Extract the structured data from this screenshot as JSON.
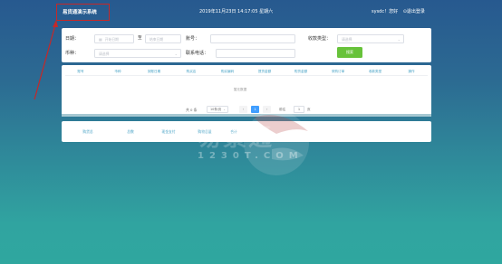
{
  "header": {
    "app_title": "易货通演示系统",
    "datetime": "2019年11月23日 14:17:05 星期六",
    "greeting": "sysdc！您好",
    "logout": "⊙退出登录"
  },
  "filters": {
    "date_label": "日期：",
    "date_start_placeholder": "开始日期",
    "date_separator": "至",
    "date_end_placeholder": "结束日期",
    "account_label": "账号：",
    "account_value": "",
    "collect_type_label": "收款类型：",
    "collect_type_placeholder": "请选择",
    "currency_label": "币种：",
    "currency_placeholder": "请选择",
    "contact_phone_label": "联系电话：",
    "contact_phone_value": "",
    "search_button": "搜索"
  },
  "table": {
    "columns": [
      "账号",
      "币种",
      "到账日期",
      "购买店",
      "购买编码",
      "提货金额",
      "购货金额",
      "采购订单",
      "收款类型",
      "操作"
    ],
    "empty_text": "暂无数据"
  },
  "pagination": {
    "total": "共 0 条",
    "page_size": "10条/页",
    "prev": "‹",
    "current_page": "1",
    "next": "›",
    "goto_label": "前往",
    "goto_value": "1",
    "page_suffix": "页"
  },
  "summary": {
    "items": [
      "购货总",
      "总数",
      "现金支付",
      "购物总量",
      "合计"
    ]
  },
  "watermark": {
    "brand": "易景通",
    "domain": "1230T.COM"
  },
  "colors": {
    "accent": "#409eff",
    "search_button": "#67c23a",
    "header_text": "#4aa3c6",
    "annotation": "#c62828"
  }
}
